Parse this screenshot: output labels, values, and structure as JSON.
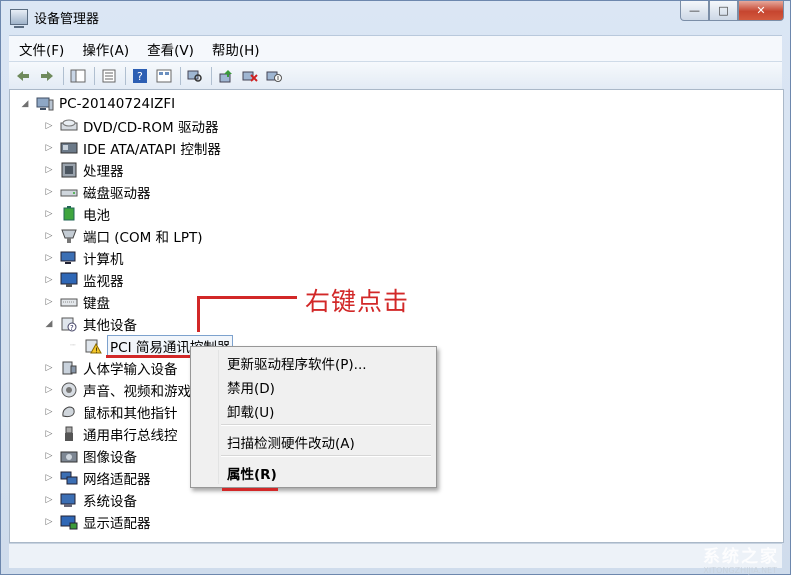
{
  "window": {
    "title": "设备管理器"
  },
  "caption": {
    "minimize": "—",
    "maximize": "□",
    "close": "✕"
  },
  "menu": [
    "文件(F)",
    "操作(A)",
    "查看(V)",
    "帮助(H)"
  ],
  "toolbar": {
    "icons": [
      "back-icon",
      "forward-icon",
      "show-hide-tree-icon",
      "properties-icon",
      "help-icon",
      "view-icon",
      "scan-hardware-icon",
      "update-driver-icon",
      "uninstall-icon",
      "disable-icon"
    ]
  },
  "tree": {
    "root": "PC-20140724IZFI",
    "items": [
      "DVD/CD-ROM 驱动器",
      "IDE ATA/ATAPI 控制器",
      "处理器",
      "磁盘驱动器",
      "电池",
      "端口 (COM 和 LPT)",
      "计算机",
      "监视器",
      "键盘",
      "其他设备",
      "PCI 简易通讯控制器",
      "人体学输入设备",
      "声音、视频和游戏控制器",
      "鼠标和其他指针设备",
      "通用串行总线控制器",
      "图像设备",
      "网络适配器",
      "系统设备",
      "显示适配器"
    ],
    "visible_items": [
      "DVD/CD-ROM 驱动器",
      "IDE ATA/ATAPI 控制器",
      "处理器",
      "磁盘驱动器",
      "电池",
      "端口 (COM 和 LPT)",
      "计算机",
      "监视器",
      "键盘",
      "其他设备",
      "PCI 简易通讯控制器",
      "人体学输入设备",
      "声音、视频和游戏",
      "鼠标和其他指针",
      "通用串行总线控",
      "图像设备",
      "网络适配器",
      "系统设备",
      "显示适配器"
    ]
  },
  "context_menu": {
    "update": "更新驱动程序软件(P)...",
    "disable": "禁用(D)",
    "uninstall": "卸载(U)",
    "scan": "扫描检测硬件改动(A)",
    "properties": "属性(R)"
  },
  "annotation": {
    "text": "右键点击",
    "color": "#d22828"
  },
  "watermark": {
    "text": "系统之家",
    "sub": "XITONGZHIJIA.NET"
  }
}
